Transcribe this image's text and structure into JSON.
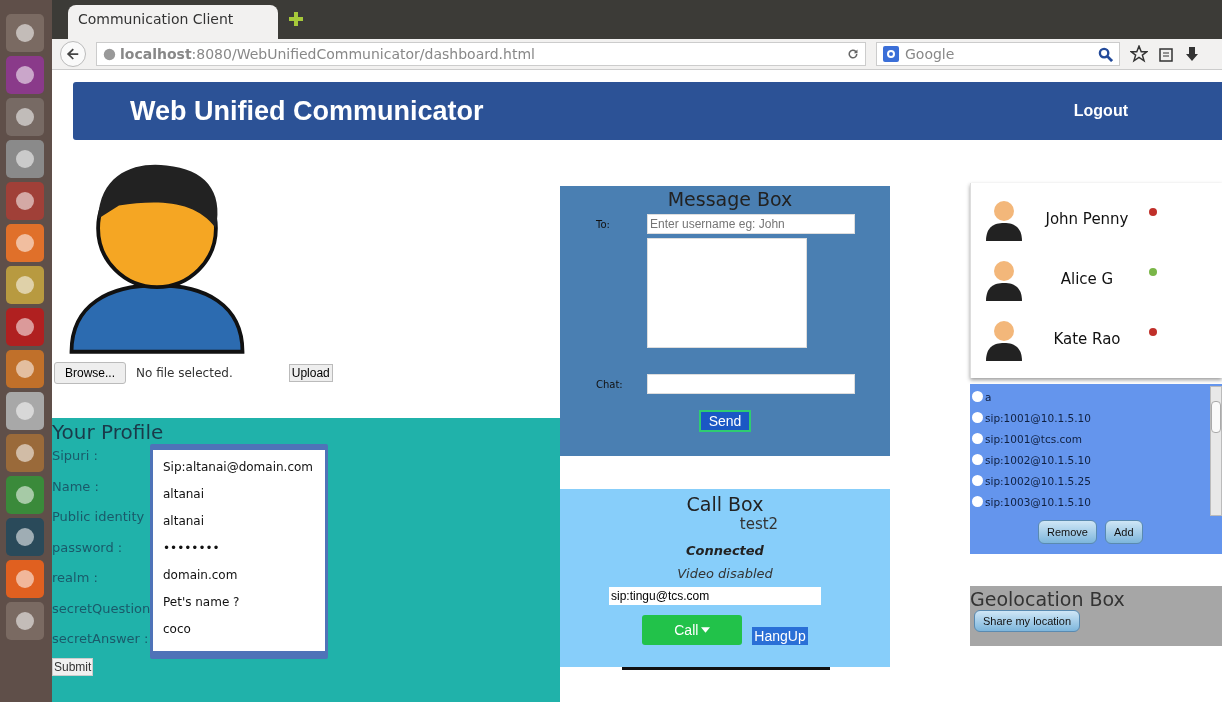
{
  "browser": {
    "tab_title": "Communication Client",
    "url": "**localhost**:8080/WebUnifiedCommunicator/dashboard.html",
    "search_placeholder": "Google"
  },
  "header": {
    "title": "Web Unified Communicator",
    "logout": "Logout"
  },
  "upload": {
    "browse": "Browse...",
    "file_status": "No file selected.",
    "upload": "Upload"
  },
  "profile": {
    "title": "Your Profile",
    "submit": "Submit",
    "fields": [
      {
        "label": "Sipuri :",
        "value": "Sip:altanai@domain.com"
      },
      {
        "label": "Name :",
        "value": "altanai"
      },
      {
        "label": "Public identity",
        "value": "altanai"
      },
      {
        "label": "password :",
        "value": "••••••••"
      },
      {
        "label": "realm :",
        "value": "domain.com"
      },
      {
        "label": "secretQuestion",
        "value": "Pet's name ?"
      },
      {
        "label": "secretAnswer :",
        "value": "coco"
      }
    ]
  },
  "message_box": {
    "title": "Message Box",
    "to_label": "To:",
    "to_placeholder": "Enter username eg: John",
    "chat_label": "Chat:",
    "send": "Send"
  },
  "call_box": {
    "title": "Call Box",
    "callee": "test2",
    "status": "Connected",
    "video": "Video disabled",
    "address": "sip:tingu@tcs.com",
    "call": "Call",
    "hangup": "HangUp"
  },
  "contacts": [
    {
      "name": "John Penny",
      "color": "#c0302a"
    },
    {
      "name": "Alice G",
      "color": "#7ab648"
    },
    {
      "name": "Kate Rao",
      "color": "#c0302a"
    }
  ],
  "sip_list": {
    "items": [
      {
        "label": "a",
        "selected": false
      },
      {
        "label": "sip:1001@10.1.5.10",
        "selected": false
      },
      {
        "label": "sip:1001@tcs.com",
        "selected": false
      },
      {
        "label": "sip:1002@10.1.5.10",
        "selected": false
      },
      {
        "label": "sip:1002@10.1.5.25",
        "selected": false
      },
      {
        "label": "sip:1003@10.1.5.10",
        "selected": false
      }
    ],
    "remove": "Remove",
    "add": "Add"
  },
  "geolocation": {
    "title": "Geolocation Box",
    "share": "Share my location"
  }
}
